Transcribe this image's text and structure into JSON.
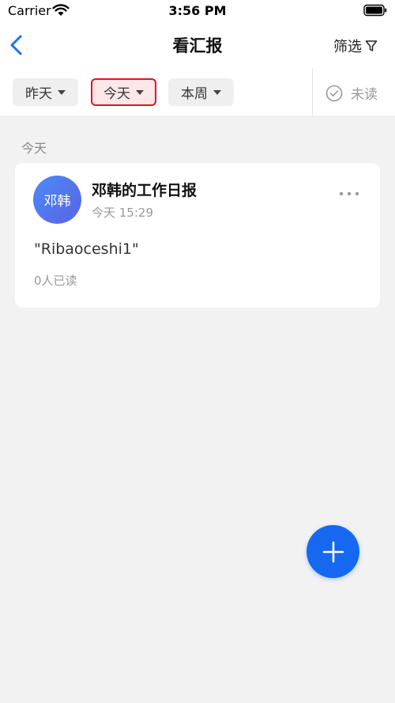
{
  "status_bar": {
    "carrier": "Carrier",
    "time": "3:56 PM"
  },
  "nav": {
    "title": "看汇报",
    "filter_label": "筛选"
  },
  "filters": {
    "chips": [
      {
        "label": "昨天",
        "active": false
      },
      {
        "label": "今天",
        "active": true
      },
      {
        "label": "本周",
        "active": false
      }
    ],
    "unread_label": "未读"
  },
  "section": {
    "label": "今天"
  },
  "report": {
    "avatar_text": "邓韩",
    "title": "邓韩的工作日报",
    "time": "今天 15:29",
    "content": "\"Ribaoceshi1\"",
    "read_count": "0人已读"
  },
  "colors": {
    "accent": "#1768f0",
    "active_chip_border": "#e0141e",
    "active_chip_bg": "#fde7e9"
  },
  "icons": {
    "back": "chevron-left-icon",
    "filter": "funnel-icon",
    "unread": "check-circle-icon",
    "more": "more-dots-icon",
    "fab": "plus-icon"
  }
}
